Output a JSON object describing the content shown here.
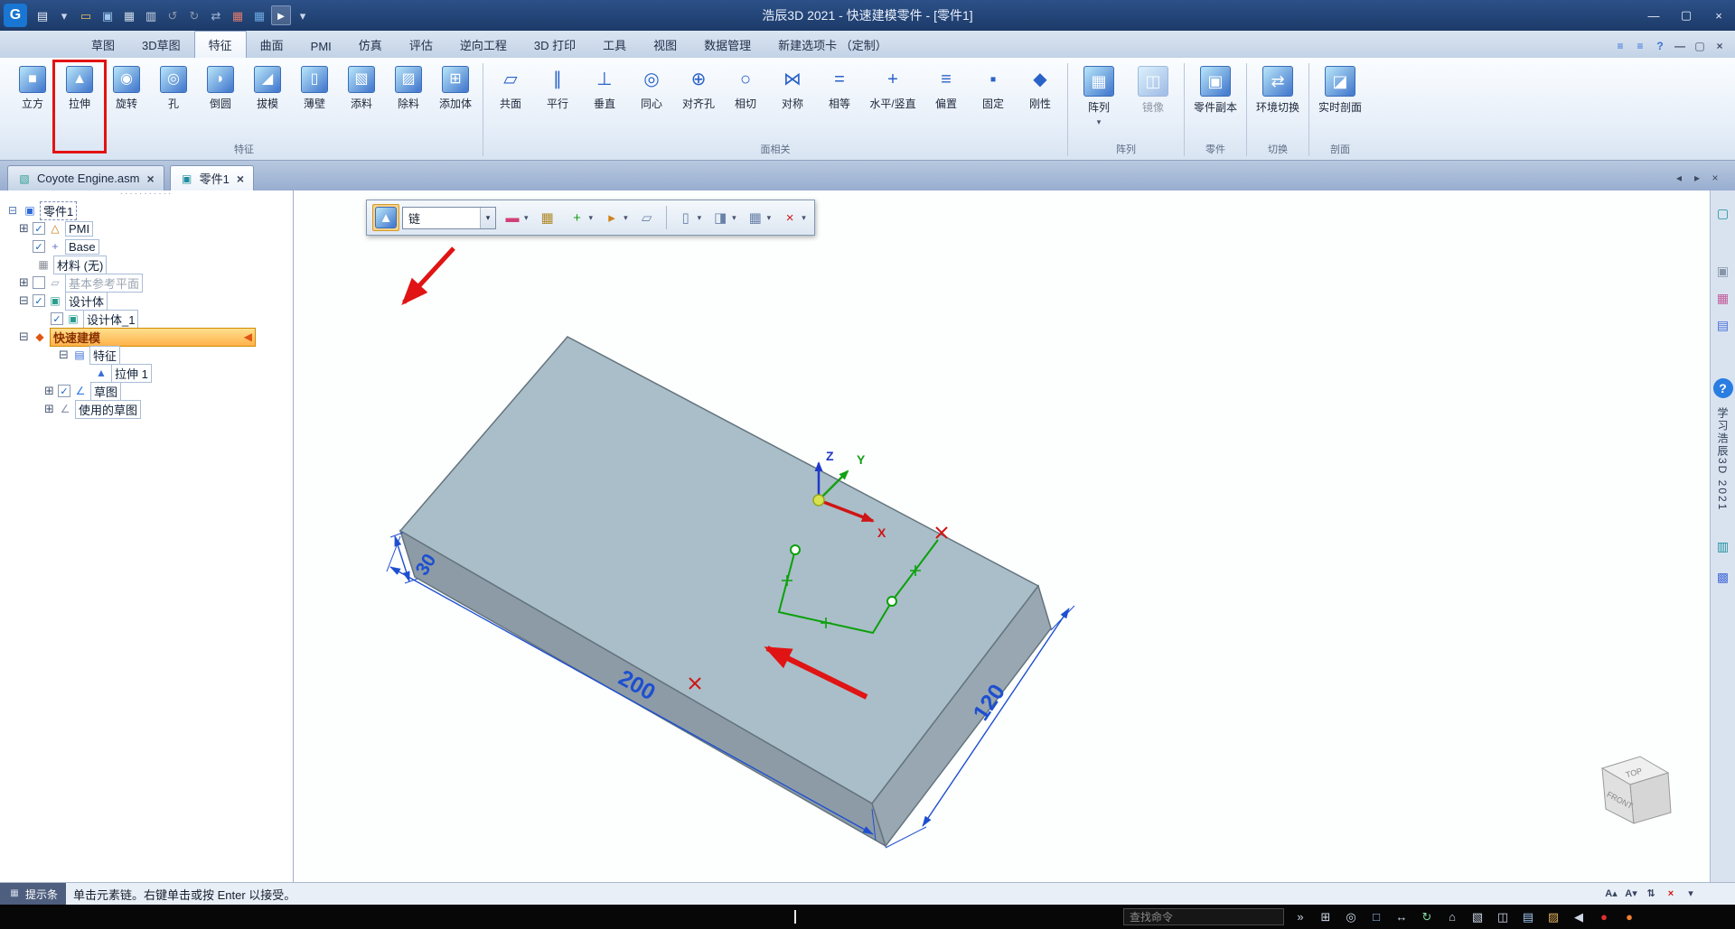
{
  "window": {
    "title": "浩辰3D 2021 - 快速建模零件 - [零件1]",
    "controls": [
      "minimize",
      "maximize",
      "close"
    ]
  },
  "quick_access": {
    "icons": [
      "app-logo",
      "new-document-icon",
      "new-dropdown-icon",
      "open-icon",
      "save-icon",
      "print-icon",
      "print-preview-icon",
      "undo-icon",
      "redo-icon",
      "link-icon",
      "table-red-icon",
      "table-blue-icon",
      "select-tool-icon",
      "qat-customize-icon"
    ]
  },
  "ribbon": {
    "tabs": [
      "草图",
      "3D草图",
      "特征",
      "曲面",
      "PMI",
      "仿真",
      "评估",
      "逆向工程",
      "3D 打印",
      "工具",
      "视图",
      "数据管理",
      "新建选项卡 （定制）"
    ],
    "active_tab": "特征",
    "right_icons": [
      "mini-toolbar-icon",
      "mini-toolbar2-icon",
      "help-small-icon",
      "doc-minimize-icon",
      "doc-restore-icon",
      "doc-close-icon"
    ],
    "groups": [
      {
        "name": "特征",
        "style": "grad",
        "buttons": [
          {
            "label": "立方",
            "icon": "box-icon"
          },
          {
            "label": "拉伸",
            "icon": "extrude-icon"
          },
          {
            "label": "旋转",
            "icon": "revolve-icon"
          },
          {
            "label": "孔",
            "icon": "hole-icon"
          },
          {
            "label": "倒圆",
            "icon": "round-icon"
          },
          {
            "label": "拔模",
            "icon": "draft-icon"
          },
          {
            "label": "薄壁",
            "icon": "thinwall-icon"
          },
          {
            "label": "添料",
            "icon": "add-material-icon"
          },
          {
            "label": "除料",
            "icon": "cut-material-icon"
          },
          {
            "label": "添加体",
            "icon": "add-body-icon"
          }
        ]
      },
      {
        "name": "面相关",
        "style": "flat",
        "buttons": [
          {
            "label": "共面",
            "icon": "coplanar-icon"
          },
          {
            "label": "平行",
            "icon": "parallel-icon"
          },
          {
            "label": "垂直",
            "icon": "perpendicular-icon"
          },
          {
            "label": "同心",
            "icon": "concentric-icon"
          },
          {
            "label": "对齐孔",
            "icon": "align-holes-icon"
          },
          {
            "label": "相切",
            "icon": "tangent-icon"
          },
          {
            "label": "对称",
            "icon": "symmetric-icon"
          },
          {
            "label": "相等",
            "icon": "equal-icon"
          },
          {
            "label": "水平/竖直",
            "icon": "horizontal-vertical-icon",
            "wide": true
          },
          {
            "label": "偏置",
            "icon": "offset-icon"
          },
          {
            "label": "固定",
            "icon": "fixed-icon"
          },
          {
            "label": "刚性",
            "icon": "rigid-icon"
          }
        ]
      },
      {
        "name": "阵列",
        "style": "grad",
        "big": true,
        "buttons": [
          {
            "label": "阵列",
            "icon": "pattern-icon",
            "dropdown": true
          },
          {
            "label": "镜像",
            "icon": "mirror-icon",
            "disabled": true
          }
        ]
      },
      {
        "name": "零件",
        "style": "grad",
        "big": true,
        "buttons": [
          {
            "label": "零件副本",
            "icon": "part-copy-icon"
          }
        ]
      },
      {
        "name": "切换",
        "style": "grad",
        "big": true,
        "buttons": [
          {
            "label": "环境切换",
            "icon": "env-switch-icon"
          }
        ]
      },
      {
        "name": "剖面",
        "style": "grad",
        "big": true,
        "buttons": [
          {
            "label": "实时剖面",
            "icon": "live-section-icon"
          }
        ]
      }
    ]
  },
  "document_tabs": {
    "tabs": [
      {
        "label": "Coyote Engine.asm",
        "icon": "assembly-doc-icon",
        "active": false
      },
      {
        "label": "零件1",
        "icon": "part-doc-icon",
        "active": true
      }
    ],
    "nav_icons": [
      "tab-back-icon",
      "tab-forward-icon",
      "tabs-close-icon"
    ]
  },
  "tree": {
    "rows": [
      {
        "pl": 6,
        "icons": [
          "tree-struct-icon",
          "part-root-icon"
        ],
        "label": "零件1",
        "dashed": true
      },
      {
        "pl": 20,
        "exp": "plus",
        "check": true,
        "icons": [
          "pmi-icon"
        ],
        "label": "PMI",
        "box": true
      },
      {
        "pl": 36,
        "check": true,
        "icons": [
          "base-icon"
        ],
        "label": "Base",
        "box": true
      },
      {
        "pl": 40,
        "icons": [
          "material-icon"
        ],
        "label": "材料 (无)",
        "box": true
      },
      {
        "pl": 20,
        "exp": "plus",
        "check": false,
        "icons": [
          "ref-plane-icon"
        ],
        "label": "基本参考平面",
        "box": true,
        "gray": true
      },
      {
        "pl": 20,
        "exp": "minus",
        "check": true,
        "icons": [
          "design-body-icon"
        ],
        "label": "设计体",
        "box": true
      },
      {
        "pl": 56,
        "check": true,
        "icons": [
          "design-body-icon"
        ],
        "label": "设计体_1",
        "box": true
      },
      {
        "pl": 20,
        "exp": "minus",
        "icons": [
          "quick-model-icon"
        ],
        "label": "快速建模",
        "highlight": true,
        "pointer": true
      },
      {
        "pl": 64,
        "exp": "minus",
        "icons": [
          "feature-group-icon"
        ],
        "label": "特征",
        "box": true
      },
      {
        "pl": 104,
        "icons": [
          "extrude-feature-icon"
        ],
        "label": "拉伸 1",
        "box": true
      },
      {
        "pl": 48,
        "exp": "plus",
        "check": true,
        "icons": [
          "sketch-icon"
        ],
        "label": "草图",
        "box": true
      },
      {
        "pl": 48,
        "exp": "plus",
        "icons": [
          "used-sketch-icon"
        ],
        "label": "使用的草图",
        "box": true
      }
    ]
  },
  "command_bar": {
    "chain_value": "链",
    "items": [
      {
        "type": "btn",
        "icon": "extrude-mode-icon",
        "pressed": true
      },
      {
        "type": "select"
      },
      {
        "type": "btn",
        "icon": "line-color-icon",
        "dropdown": true
      },
      {
        "type": "btn",
        "icon": "keypoint-icon"
      },
      {
        "type": "btn",
        "icon": "add-geometry-icon",
        "dropdown": true
      },
      {
        "type": "btn",
        "icon": "direction-step-icon",
        "dropdown": true
      },
      {
        "type": "btn",
        "icon": "side-step-icon"
      },
      {
        "type": "sep"
      },
      {
        "type": "btn",
        "icon": "extent-limit-icon",
        "dropdown": true
      },
      {
        "type": "btn",
        "icon": "treatment-icon",
        "dropdown": true
      },
      {
        "type": "btn",
        "icon": "parameter-table-icon",
        "dropdown": true
      },
      {
        "type": "btn",
        "icon": "cancel-icon",
        "dropdown": true
      }
    ]
  },
  "viewport": {
    "dims": {
      "length": "200",
      "width": "120",
      "height": "30"
    },
    "axes": {
      "x": "X",
      "y": "Y",
      "z": "Z"
    },
    "view_cube": {
      "top": "TOP",
      "front": "FRONT"
    }
  },
  "right_panel": {
    "items": [
      {
        "icon": "display-monitor-icon",
        "mt": 14
      },
      {
        "icon": "screenshot-icon",
        "mt": 42
      },
      {
        "icon": "color-swatch-icon",
        "mt": 8
      },
      {
        "icon": "layers-icon",
        "mt": 8
      },
      {
        "icon": "help-icon",
        "mt": 48
      },
      {
        "vtext": "学习浩辰3D 2021",
        "mt": 10
      },
      {
        "icon": "library-icon",
        "mt": 28
      },
      {
        "icon": "tools-icon",
        "mt": 12
      }
    ]
  },
  "status_bar": {
    "label": "提示条",
    "message": "单击元素链。右键单击或按 Enter 以接受。",
    "icons": [
      "font-increase-icon",
      "font-decrease-icon",
      "scroll-toggle-icon",
      "prompt-close-icon",
      "prompt-expand-icon"
    ]
  },
  "bottom_bar": {
    "search_placeholder": "查找命令",
    "icons": [
      "overflow-icon",
      "zoom-window-icon",
      "zoom-icon",
      "fit-icon",
      "pan-icon",
      "rotate-icon",
      "home-view-icon",
      "view-styles-icon",
      "window-layout-icon",
      "edge-display-icon",
      "color-manager-icon",
      "speaker-icon",
      "record-icon",
      "capture-icon"
    ]
  }
}
